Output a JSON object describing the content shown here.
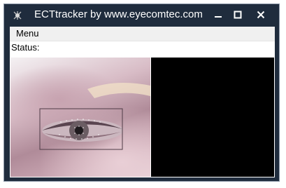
{
  "window": {
    "title": "ECTtracker by www.eyecomtec.com",
    "controls": {
      "minimize": "minimize-icon",
      "maximize": "maximize-icon",
      "close": "close-icon"
    }
  },
  "menu": {
    "items": [
      "Menu"
    ]
  },
  "status": {
    "label": "Status:",
    "value": ""
  },
  "colors": {
    "titlebar": "#1f2c3d",
    "menubar": "#f0f0f0",
    "panel": "#000000"
  }
}
